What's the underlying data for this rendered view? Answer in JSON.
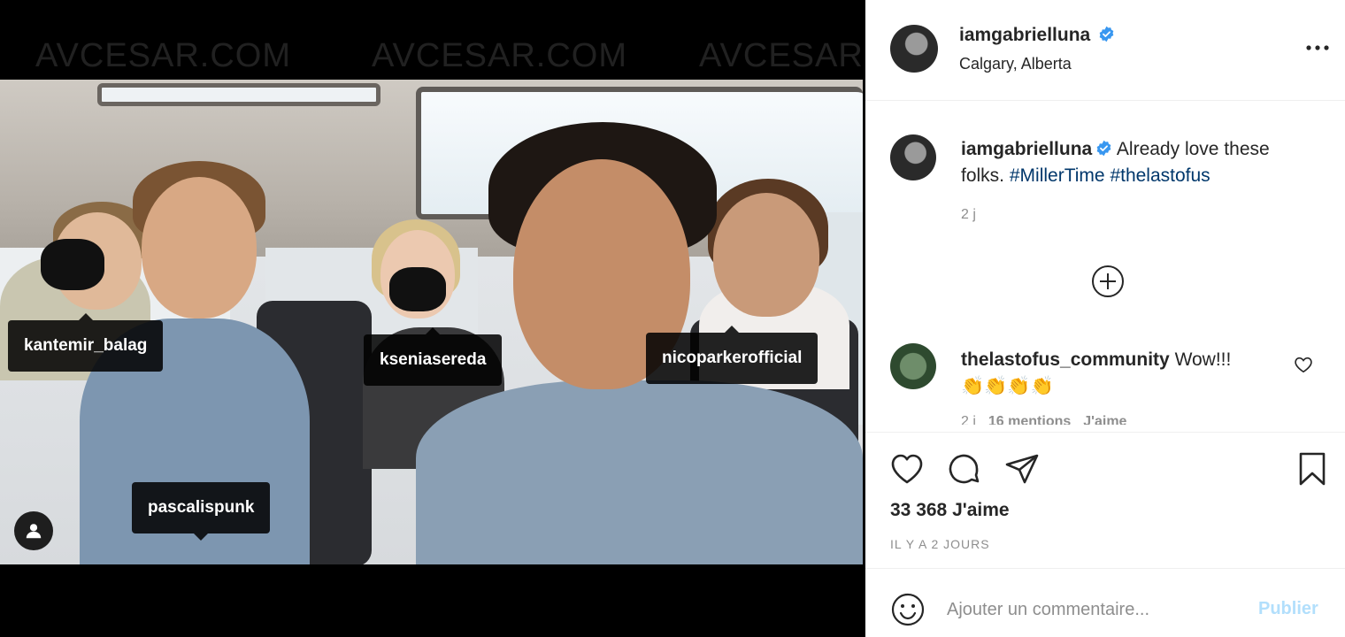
{
  "watermark": {
    "text_1": "AVCESAR.COM",
    "text_2": "AVCESAR.COM",
    "text_3": "AVCESAR.COM"
  },
  "tags": {
    "t1": "kantemir_balag",
    "t2": "kseniasereda",
    "t3": "nicoparkerofficial",
    "t4": "pascalispunk"
  },
  "header": {
    "username": "iamgabrielluna",
    "location": "Calgary, Alberta"
  },
  "caption": {
    "username": "iamgabrielluna",
    "text": "Already love these folks.",
    "hashtag_1": "#MillerTime",
    "hashtag_2": "#thelastofus",
    "time": "2 j"
  },
  "comment": {
    "username": "thelastofus_community",
    "text": "Wow!!!",
    "emoji": "👏👏👏👏",
    "time": "2 j",
    "mentions": "16 mentions",
    "like_label": "J'aime"
  },
  "actions": {
    "likes": "33 368 J'aime",
    "date": "IL Y A 2 JOURS"
  },
  "comment_box": {
    "placeholder": "Ajouter un commentaire...",
    "post_label": "Publier"
  },
  "colors": {
    "link": "#00376b",
    "verified": "#3897f0",
    "post_button_disabled": "#b2dffc",
    "muted": "#8e8e8e"
  },
  "icons": [
    "more-icon",
    "verified-icon",
    "load-more-icon",
    "heart-icon",
    "comment-icon",
    "share-icon",
    "bookmark-icon",
    "emoji-icon",
    "user-tags-icon"
  ]
}
